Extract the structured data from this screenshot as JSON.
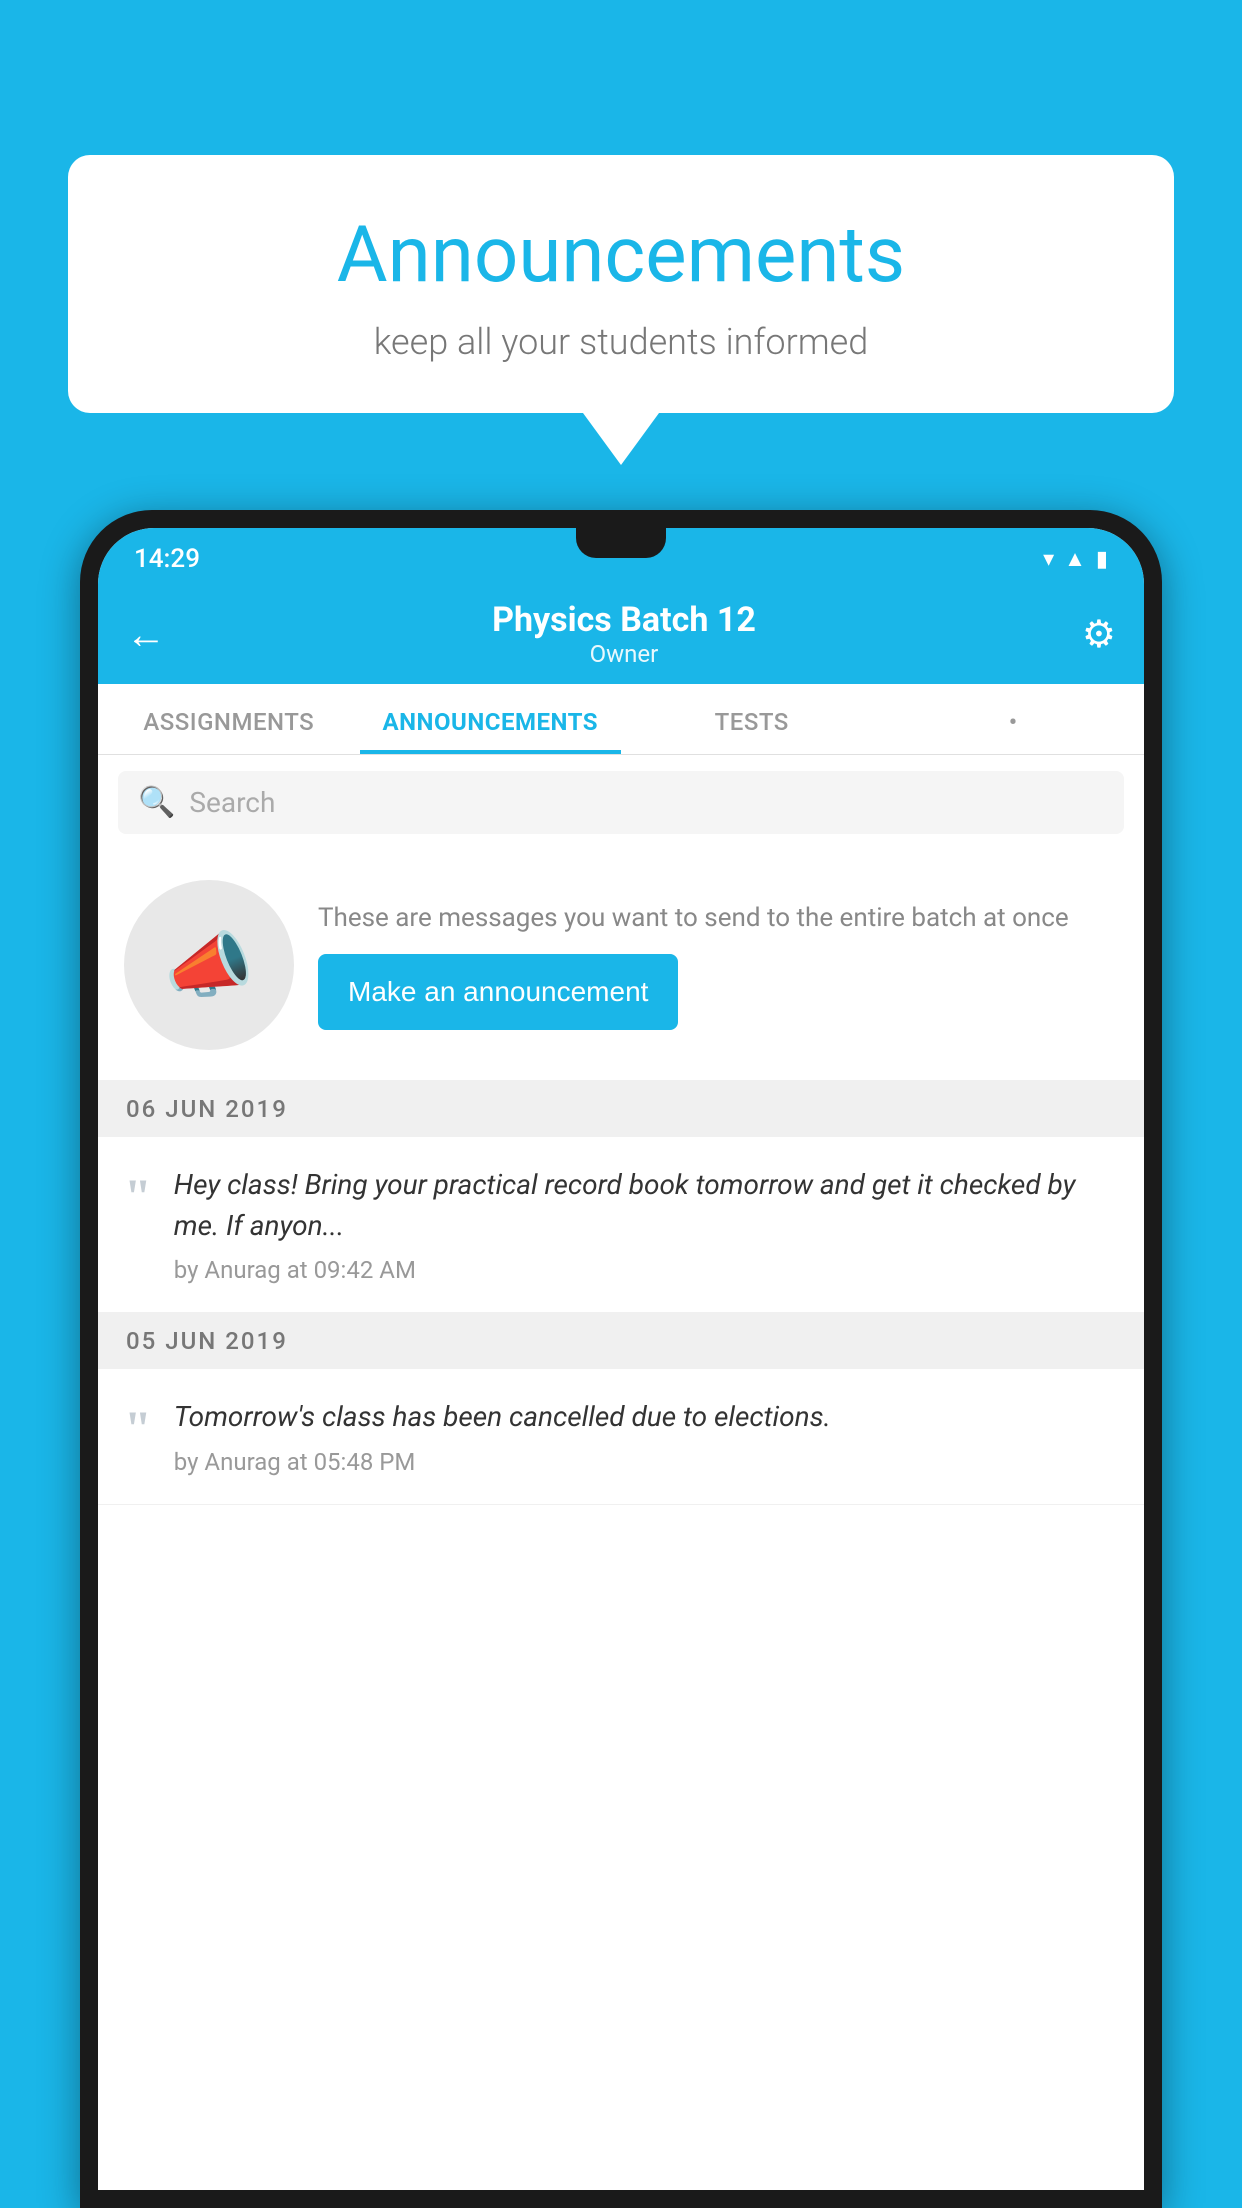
{
  "background_color": "#1ab6e8",
  "speech_bubble": {
    "title": "Announcements",
    "subtitle": "keep all your students informed"
  },
  "status_bar": {
    "time": "14:29",
    "icons": [
      "wifi",
      "signal",
      "battery"
    ]
  },
  "header": {
    "title": "Physics Batch 12",
    "subtitle": "Owner",
    "back_label": "←",
    "gear_label": "⚙"
  },
  "tabs": [
    {
      "label": "ASSIGNMENTS",
      "active": false
    },
    {
      "label": "ANNOUNCEMENTS",
      "active": true
    },
    {
      "label": "TESTS",
      "active": false
    },
    {
      "label": "•",
      "active": false
    }
  ],
  "search": {
    "placeholder": "Search"
  },
  "promo": {
    "description": "These are messages you want to send to the entire batch at once",
    "button_label": "Make an announcement"
  },
  "dates": [
    {
      "label": "06  JUN  2019",
      "announcements": [
        {
          "text": "Hey class! Bring your practical record book tomorrow and get it checked by me. If anyon...",
          "meta": "by Anurag at 09:42 AM"
        }
      ]
    },
    {
      "label": "05  JUN  2019",
      "announcements": [
        {
          "text": "Tomorrow's class has been cancelled due to elections.",
          "meta": "by Anurag at 05:48 PM"
        }
      ]
    }
  ]
}
